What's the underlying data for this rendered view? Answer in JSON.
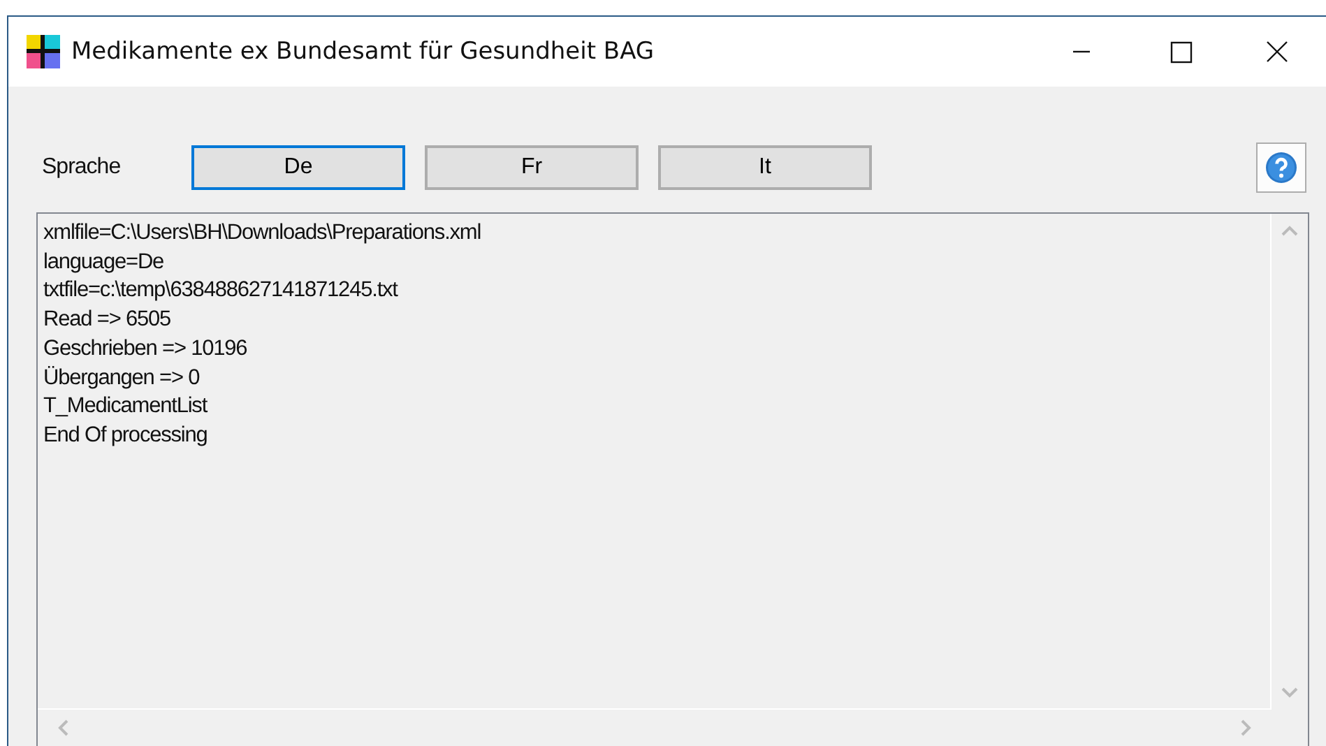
{
  "window": {
    "title": "Medikamente ex Bundesamt für Gesundheit BAG"
  },
  "language_label": "Sprache",
  "language_buttons": [
    {
      "label": "De",
      "selected": true
    },
    {
      "label": "Fr",
      "selected": false
    },
    {
      "label": "It",
      "selected": false
    }
  ],
  "log_lines": [
    "xmlfile=C:\\Users\\BH\\Downloads\\Preparations.xml",
    "language=De",
    "txtfile=c:\\temp\\638488627141871245.txt",
    "Read => 6505",
    "Geschrieben => 10196",
    "Übergangen => 0",
    "T_MedicamentList",
    "End Of processing"
  ]
}
